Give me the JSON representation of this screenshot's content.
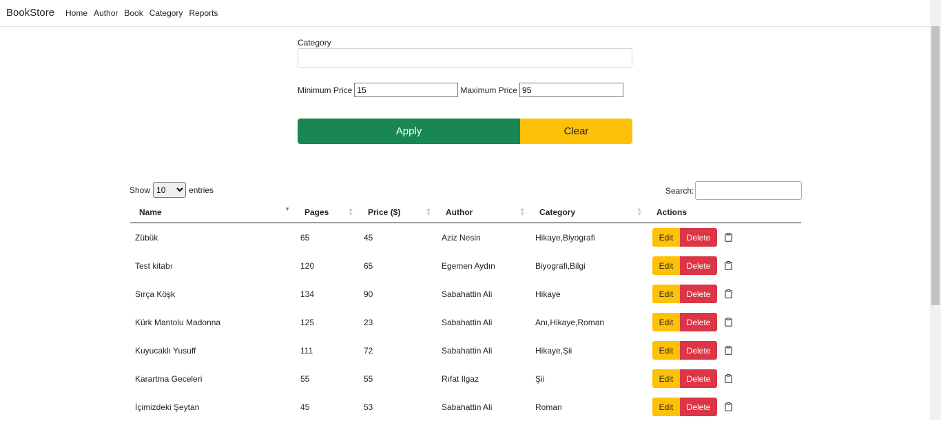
{
  "navbar": {
    "brand": "BookStore",
    "links": [
      "Home",
      "Author",
      "Book",
      "Category",
      "Reports"
    ]
  },
  "filter": {
    "category_label": "Category",
    "category_value": "",
    "min_label": "Minimum Price",
    "min_value": "15",
    "max_label": "Maximum Price",
    "max_value": "95",
    "apply_label": "Apply",
    "clear_label": "Clear"
  },
  "table_controls": {
    "show_label": "Show",
    "entries_value": "10",
    "entries_label": "entries",
    "search_label": "Search:",
    "search_value": ""
  },
  "table": {
    "headers": [
      "Name",
      "Pages",
      "Price ($)",
      "Author",
      "Category",
      "Actions"
    ],
    "edit_label": "Edit",
    "delete_label": "Delete",
    "rows": [
      {
        "name": "Zübük",
        "pages": "65",
        "price": "45",
        "author": "Aziz Nesin",
        "category": "Hikaye,Biyografi"
      },
      {
        "name": "Test kitabı",
        "pages": "120",
        "price": "65",
        "author": "Egemen Aydın",
        "category": "Biyografi,Bilgi"
      },
      {
        "name": "Sırça Köşk",
        "pages": "134",
        "price": "90",
        "author": "Sabahattin Ali",
        "category": "Hikaye"
      },
      {
        "name": "Kürk Mantolu Madonna",
        "pages": "125",
        "price": "23",
        "author": "Sabahattin Ali",
        "category": "Anı,Hikaye,Roman"
      },
      {
        "name": "Kuyucaklı Yusuff",
        "pages": "111",
        "price": "72",
        "author": "Sabahattin Ali",
        "category": "Hikaye,Şii"
      },
      {
        "name": "Karartma Geceleri",
        "pages": "55",
        "price": "55",
        "author": "Rıfat Ilgaz",
        "category": "Şii"
      },
      {
        "name": "İçimizdeki Şeytan",
        "pages": "45",
        "price": "53",
        "author": "Sabahattin Ali",
        "category": "Roman"
      }
    ]
  },
  "colors": {
    "apply": "#198754",
    "clear": "#ffc107",
    "edit": "#ffc107",
    "delete": "#dc3545"
  },
  "icons": {
    "row_action": "clipboard-icon"
  }
}
